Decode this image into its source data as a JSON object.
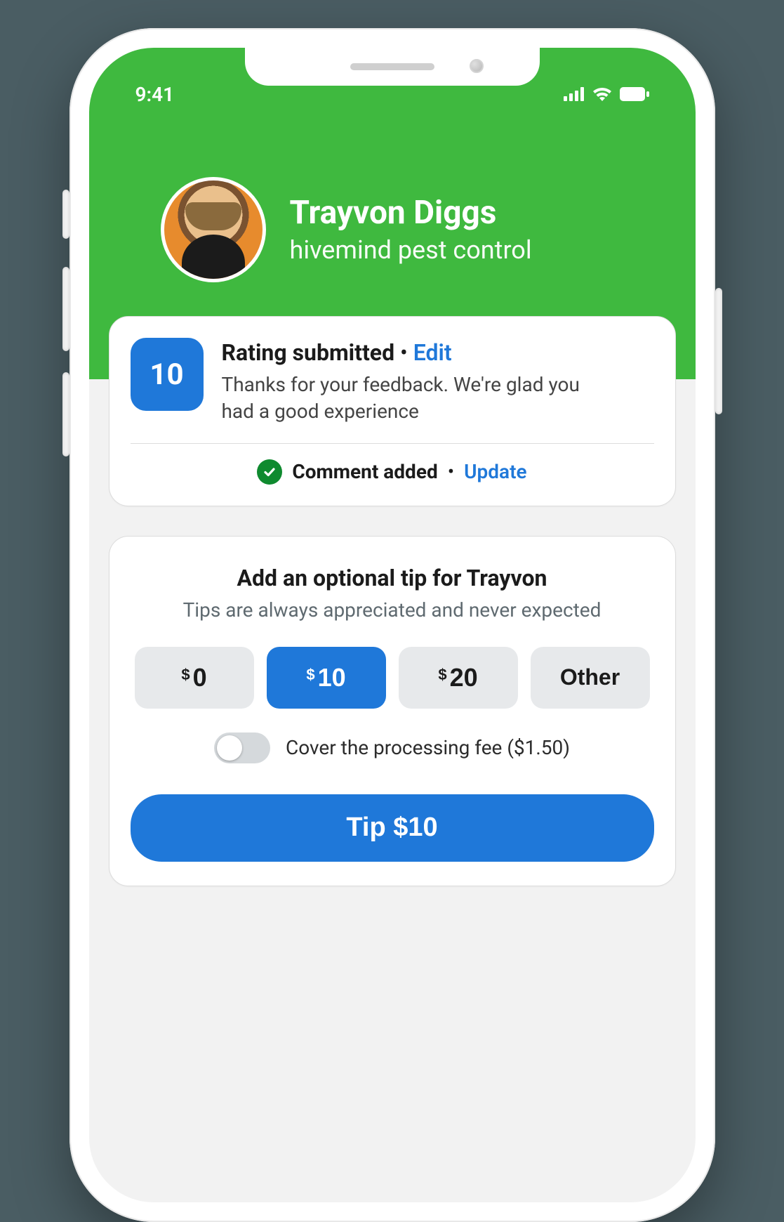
{
  "status_bar": {
    "time": "9:41"
  },
  "header": {
    "name": "Trayvon Diggs",
    "company": "hivemind pest control"
  },
  "rating": {
    "value": "10",
    "title": "Rating submitted",
    "edit_label": "Edit",
    "description": "Thanks for your feedback. We're glad you had a good experience",
    "comment_added": "Comment added",
    "update_label": "Update"
  },
  "tip": {
    "title": "Add an optional tip for Trayvon",
    "subtitle": "Tips are always appreciated and never expected",
    "options": [
      {
        "currency": "$",
        "amount": "0",
        "selected": false
      },
      {
        "currency": "$",
        "amount": "10",
        "selected": true
      },
      {
        "currency": "$",
        "amount": "20",
        "selected": false
      }
    ],
    "other_label": "Other",
    "cover_fee_label": "Cover the processing fee ($1.50)",
    "submit_label": "Tip $10"
  },
  "colors": {
    "green": "#3fb93f",
    "blue": "#1f78d9",
    "check_green": "#0f8a2f",
    "gray_bg": "#e7e9eb"
  }
}
